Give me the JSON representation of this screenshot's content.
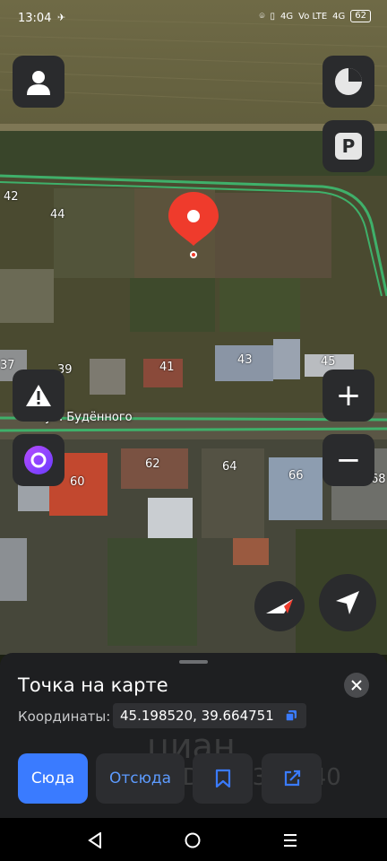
{
  "status_bar": {
    "time": "13:04",
    "network_1": "4G",
    "volte": "Vo LTE",
    "network_2": "4G",
    "battery": "62"
  },
  "map": {
    "street_name": "ул. Будённого",
    "house_numbers": [
      "42",
      "44",
      "37",
      "39",
      "41",
      "43",
      "45",
      "60",
      "62",
      "64",
      "66",
      "68"
    ]
  },
  "controls": {
    "parking_label": "P",
    "zoom_in": "+",
    "zoom_out": "−"
  },
  "sheet": {
    "title": "Точка на карте",
    "coordinates_label": "Координаты:",
    "coordinates_value": "45.198520, 39.664751"
  },
  "actions": {
    "route_to": "Сюда",
    "route_from": "Отсюда"
  },
  "watermark": {
    "brand": "циан",
    "id_text": "ID 295362040"
  },
  "colors": {
    "accent": "#3a7bff",
    "pin": "#ef3b2c",
    "sheet_bg": "#1e1f21",
    "button_bg": "#2a2b2d"
  }
}
